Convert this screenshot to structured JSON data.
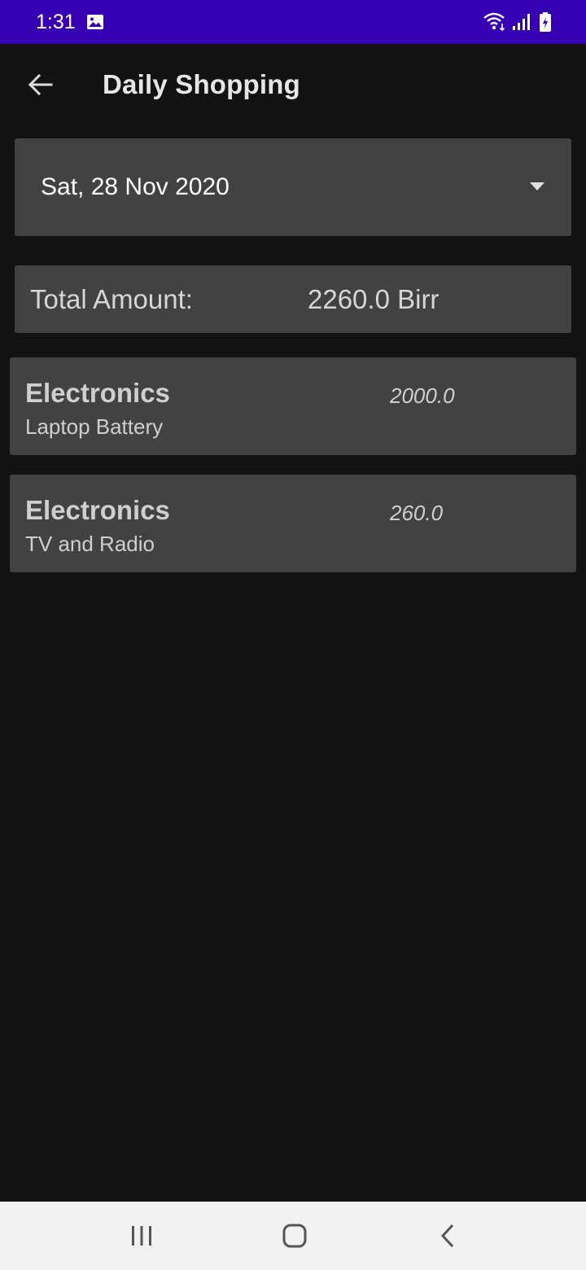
{
  "status_bar": {
    "time": "1:31",
    "icons": [
      "image-icon",
      "wifi-icon",
      "signal-icon",
      "battery-icon"
    ]
  },
  "app_bar": {
    "title": "Daily Shopping",
    "back_icon": "arrow-left-icon"
  },
  "date_selector": {
    "value": "Sat, 28 Nov 2020",
    "icon": "dropdown-arrow-icon"
  },
  "total": {
    "label": "Total Amount:",
    "value": "2260.0 Birr"
  },
  "items": [
    {
      "category": "Electronics",
      "name": "Laptop Battery",
      "amount": "2000.0"
    },
    {
      "category": "Electronics",
      "name": "TV and Radio",
      "amount": "260.0"
    }
  ],
  "nav_bar": {
    "icons": [
      "recents-icon",
      "home-icon",
      "back-icon"
    ]
  },
  "colors": {
    "status_bar": "#3700b3",
    "background": "#121212",
    "card": "#424242",
    "nav_bar": "#f2f2f2"
  }
}
